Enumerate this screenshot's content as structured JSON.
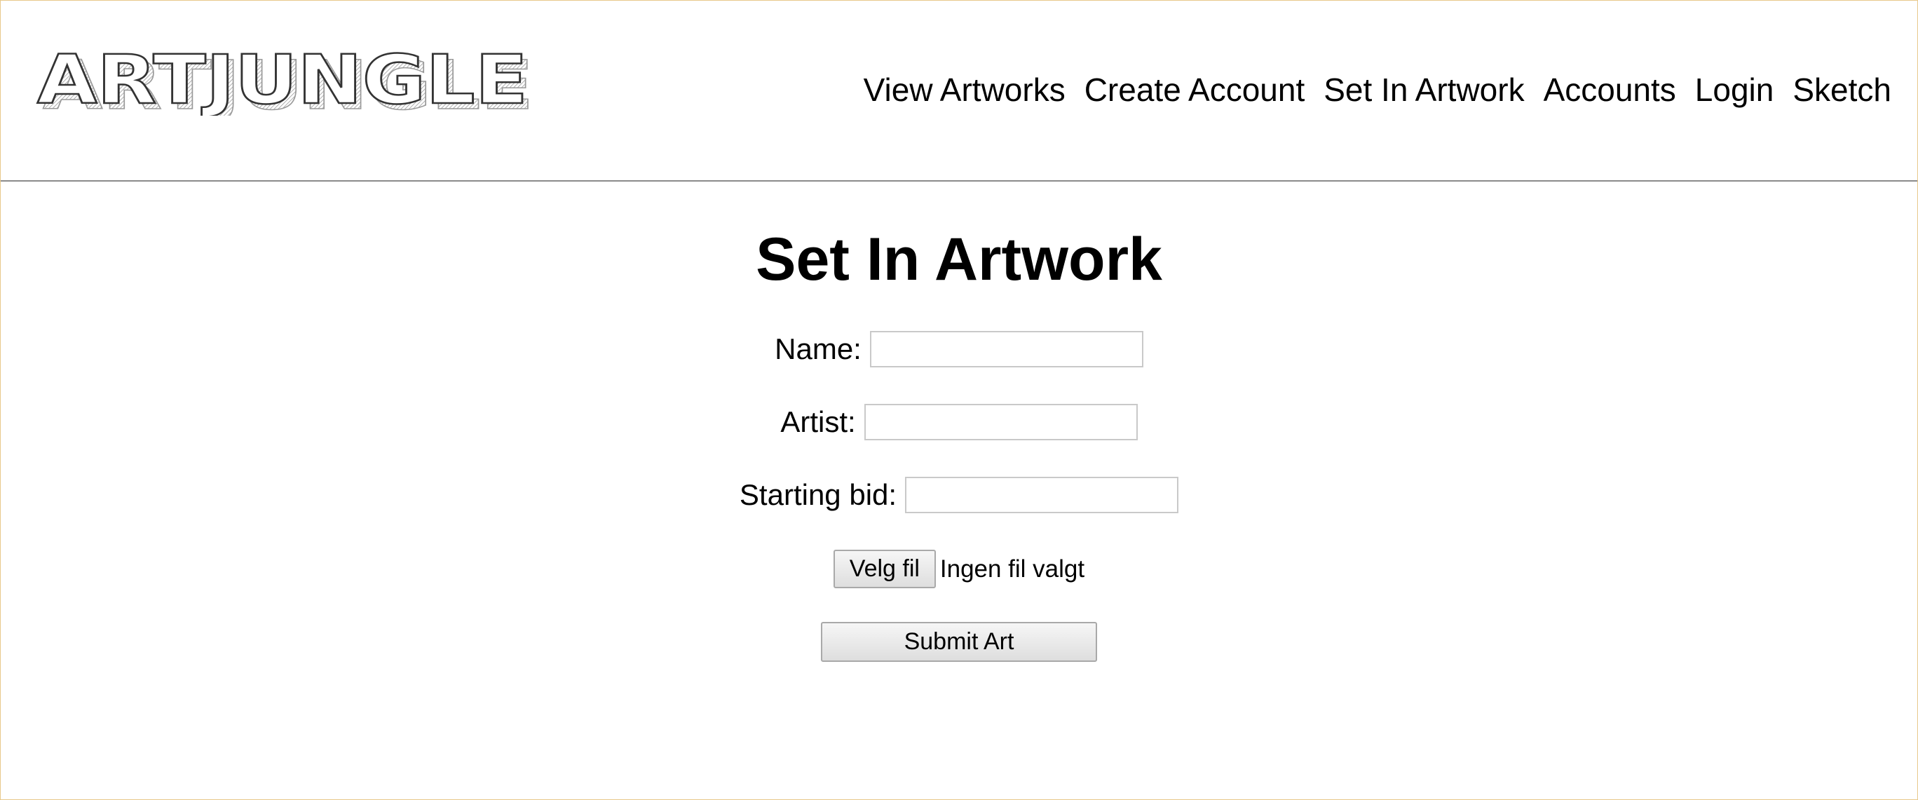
{
  "brand": {
    "logo_text": "ARTJUNGLE"
  },
  "nav": {
    "items": [
      {
        "label": "View Artworks"
      },
      {
        "label": "Create Account"
      },
      {
        "label": "Set In Artwork"
      },
      {
        "label": "Accounts"
      },
      {
        "label": "Login"
      },
      {
        "label": "Sketch"
      }
    ]
  },
  "main": {
    "title": "Set In Artwork",
    "form": {
      "name_label": "Name:",
      "name_value": "",
      "artist_label": "Artist:",
      "artist_value": "",
      "bid_label": "Starting bid:",
      "bid_value": "",
      "file_button_label": "Velg fil",
      "file_status": "Ingen fil valgt",
      "submit_label": "Submit Art"
    }
  },
  "colors": {
    "frame_border": "#e8c88a",
    "header_divider": "#8a8a8a",
    "input_border": "#c9c9c9"
  }
}
